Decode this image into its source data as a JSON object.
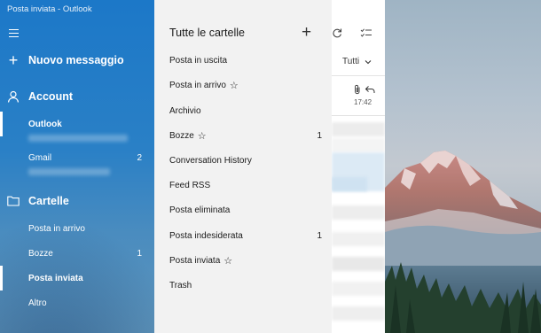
{
  "window": {
    "title": "Posta inviata - Outlook"
  },
  "nav": {
    "compose_label": "Nuovo messaggio",
    "account_section": "Account",
    "accounts": [
      {
        "name": "Outlook",
        "count": ""
      },
      {
        "name": "Gmail",
        "count": "2"
      }
    ],
    "folders_section": "Cartelle",
    "folders": [
      {
        "name": "Posta in arrivo",
        "count": ""
      },
      {
        "name": "Bozze",
        "count": "1"
      },
      {
        "name": "Posta inviata",
        "count": ""
      },
      {
        "name": "Altro",
        "count": ""
      }
    ]
  },
  "flyout": {
    "title": "Tutte le cartelle",
    "items": [
      {
        "name": "Posta in uscita",
        "star": "",
        "count": ""
      },
      {
        "name": "Posta in arrivo",
        "star": "☆",
        "count": ""
      },
      {
        "name": "Archivio",
        "star": "",
        "count": ""
      },
      {
        "name": "Bozze",
        "star": "☆",
        "count": "1"
      },
      {
        "name": "Conversation History",
        "star": "",
        "count": ""
      },
      {
        "name": "Feed RSS",
        "star": "",
        "count": ""
      },
      {
        "name": "Posta eliminata",
        "star": "",
        "count": ""
      },
      {
        "name": "Posta indesiderata",
        "star": "",
        "count": "1"
      },
      {
        "name": "Posta inviata",
        "star": "☆",
        "count": ""
      },
      {
        "name": "Trash",
        "star": "",
        "count": ""
      }
    ]
  },
  "message_list": {
    "filter_label": "Tutti",
    "first_message_time": "17:42"
  },
  "icons": {
    "menu": "hamburger-icon",
    "compose": "plus-icon",
    "account": "person-icon",
    "folder": "folder-icon",
    "add_folder": "plus-icon",
    "sync": "sync-icon",
    "select": "checklist-icon",
    "attachment": "paperclip-icon",
    "replied": "reply-icon",
    "favorite": "star-icon"
  },
  "colors": {
    "nav_background": "#1c78c8",
    "flyout_background": "#f2f2f2",
    "text_on_nav": "#ffffff"
  }
}
